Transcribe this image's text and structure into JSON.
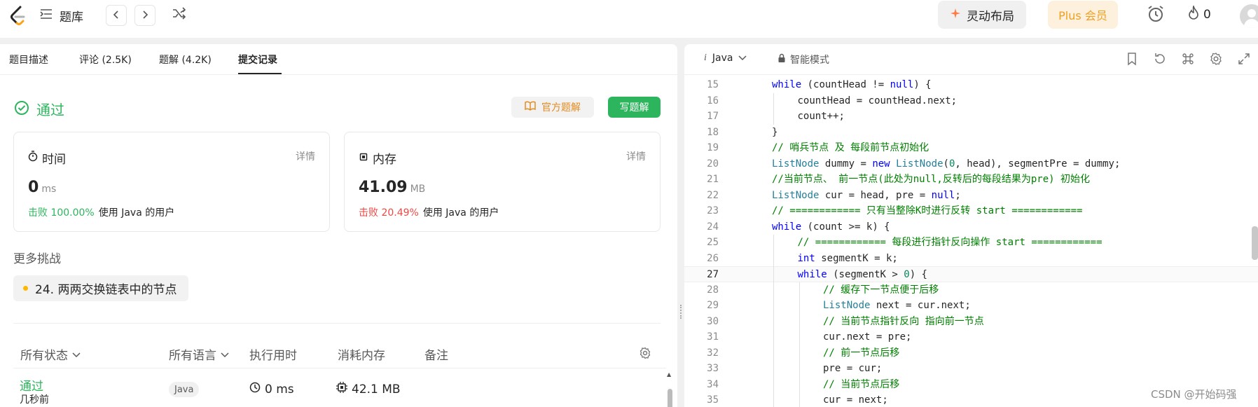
{
  "topbar": {
    "problem_list_label": "题库",
    "lingdong_label": "灵动布局",
    "plus_label": "Plus 会员",
    "fire_count": "0",
    "icons": [
      "logo-icon",
      "list-icon",
      "chevron-left-icon",
      "chevron-right-icon",
      "shuffle-icon",
      "sparkle-icon",
      "alarm-icon",
      "fire-icon",
      "avatar"
    ]
  },
  "left": {
    "tabs": [
      {
        "label": "题目描述",
        "active": false
      },
      {
        "label": "评论 (2.5K)",
        "active": false
      },
      {
        "label": "题解 (4.2K)",
        "active": false
      },
      {
        "label": "提交记录",
        "active": true
      }
    ],
    "status": "通过",
    "official_solution_label": "官方题解",
    "write_solution_label": "写题解",
    "time_card": {
      "title": "时间",
      "detail": "详情",
      "value": "0",
      "unit": "ms",
      "beat": "击败 100.00%",
      "beat_suffix": "使用 Java 的用户"
    },
    "memory_card": {
      "title": "内存",
      "detail": "详情",
      "value": "41.09",
      "unit": "MB",
      "beat": "击败 20.49%",
      "beat_suffix": "使用 Java 的用户"
    },
    "more_title": "更多挑战",
    "challenge": "24. 两两交换链表中的节点",
    "table": {
      "headers": [
        "所有状态",
        "所有语言",
        "执行用时",
        "消耗内存",
        "备注"
      ],
      "rows": [
        {
          "status": "通过",
          "time_ago": "几秒前",
          "language": "Java",
          "runtime": "0 ms",
          "memory": "42.1 MB"
        }
      ]
    },
    "colors": {
      "accepted": "#2db55d",
      "beat_red": "#ef4743",
      "official": "#e58b1e"
    }
  },
  "editor": {
    "language": "Java",
    "mode": "智能模式",
    "current_line": 27,
    "lines": [
      {
        "n": "15",
        "indent": 2
      },
      {
        "n": "16",
        "indent": 3
      },
      {
        "n": "17",
        "indent": 3
      },
      {
        "n": "18",
        "indent": 2
      },
      {
        "n": "19",
        "indent": 2
      },
      {
        "n": "20",
        "indent": 2
      },
      {
        "n": "21",
        "indent": 2
      },
      {
        "n": "22",
        "indent": 2
      },
      {
        "n": "23",
        "indent": 2
      },
      {
        "n": "24",
        "indent": 2
      },
      {
        "n": "25",
        "indent": 3
      },
      {
        "n": "26",
        "indent": 3
      },
      {
        "n": "27",
        "indent": 3
      },
      {
        "n": "28",
        "indent": 4
      },
      {
        "n": "29",
        "indent": 4
      },
      {
        "n": "30",
        "indent": 4
      },
      {
        "n": "31",
        "indent": 4
      },
      {
        "n": "32",
        "indent": 4
      },
      {
        "n": "33",
        "indent": 4
      },
      {
        "n": "34",
        "indent": 4
      },
      {
        "n": "35",
        "indent": 4
      }
    ],
    "code": [
      "while (countHead != null) {",
      "countHead = countHead.next;",
      "count++;",
      "}",
      "// 哨兵节点 及 每段前节点初始化",
      "ListNode dummy = new ListNode(0, head), segmentPre = dummy;",
      "//当前节点、 前一节点(此处为null,反转后的每段结果为pre) 初始化",
      "ListNode cur = head, pre = null;",
      "// ============ 只有当整除K时进行反转 start ============",
      "while (count >= k) {",
      "// ============ 每段进行指针反向操作 start ============",
      "int segmentK = k;",
      "while (segmentK > 0) {",
      "// 缓存下一节点便于后移",
      "ListNode next = cur.next;",
      "// 当前节点指针反向 指向前一节点",
      "cur.next = pre;",
      "// 前一节点后移",
      "pre = cur;",
      "// 当前节点后移",
      "cur = next;"
    ]
  },
  "watermark": "CSDN @开始码强"
}
